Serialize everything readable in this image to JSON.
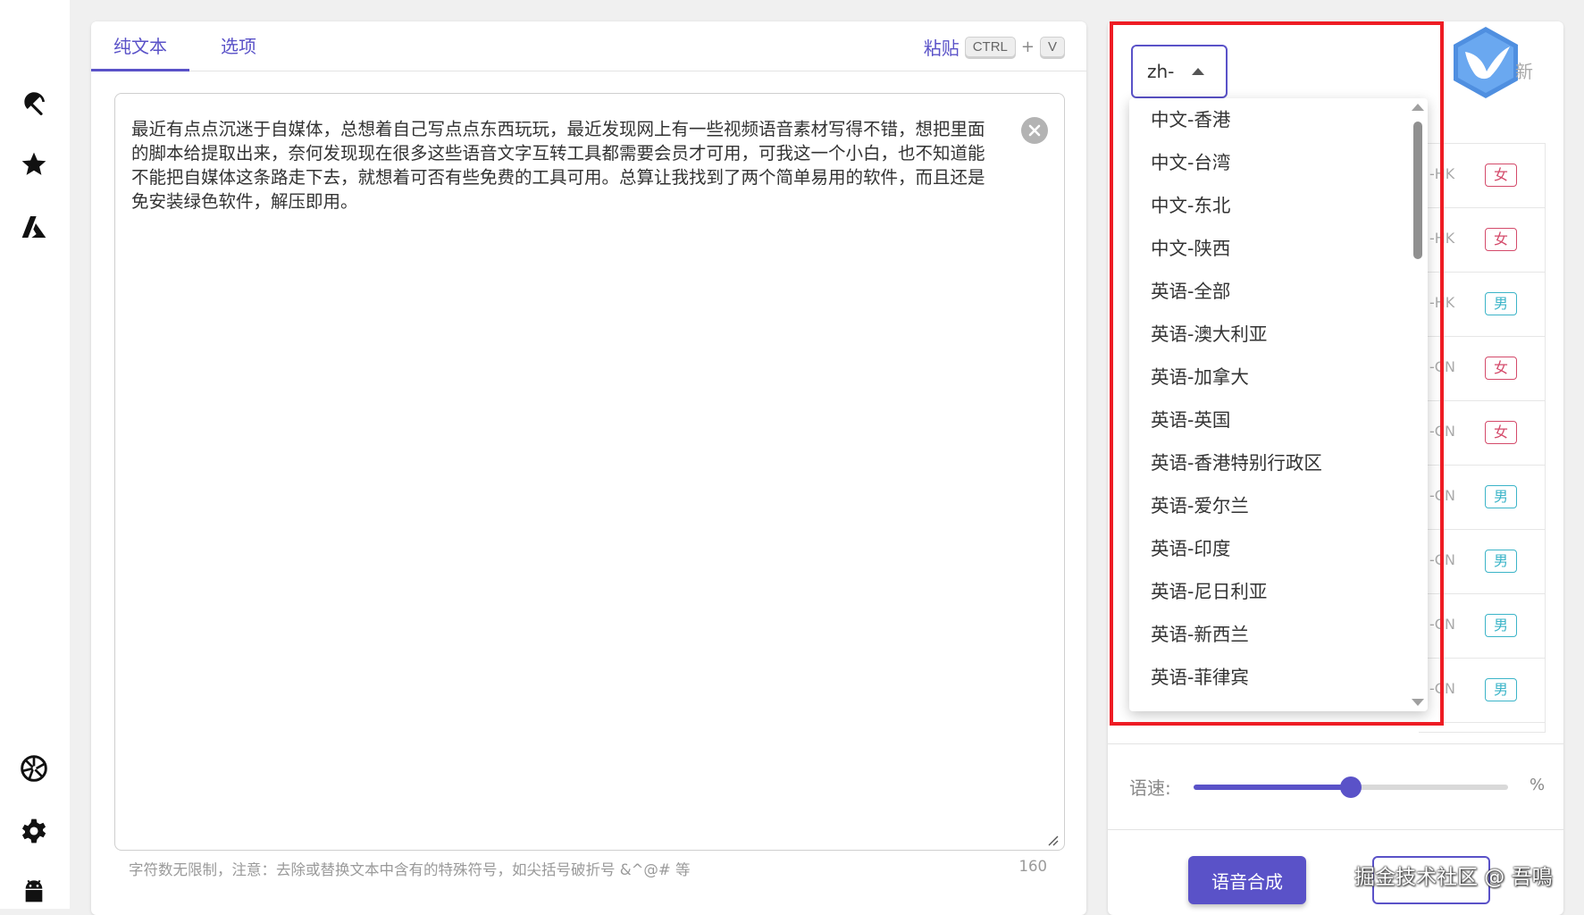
{
  "tabs": [
    {
      "label": "纯文本",
      "active": true
    },
    {
      "label": "选项",
      "active": false
    }
  ],
  "paste": {
    "label": "粘贴",
    "key1": "CTRL",
    "plus": "+",
    "key2": "V"
  },
  "editor": {
    "text": "最近有点点沉迷于自媒体，总想着自己写点点东西玩玩，最近发现网上有一些视频语音素材写得不错，想把里面的脚本给提取出来，奈何发现现在很多这些语音文字互转工具都需要会员才可用，可我这一个小白，也不知道能不能把自媒体这条路走下去，就想着可否有些免费的工具可用。总算让我找到了两个简单易用的软件，而且还是免安装绿色软件，解压即用。",
    "hint": "字符数无限制，注意：去除或替换文本中含有的特殊符号，如尖括号破折号 &^@# 等",
    "count": "160"
  },
  "language_select": {
    "value": "zh-"
  },
  "dropdown_options": [
    "中文-香港",
    "中文-台湾",
    "中文-东北",
    "中文-陕西",
    "英语-全部",
    "英语-澳大利亚",
    "英语-加拿大",
    "英语-英国",
    "英语-香港特别行政区",
    "英语-爱尔兰",
    "英语-印度",
    "英语-尼日利亚",
    "英语-新西兰",
    "英语-菲律宾"
  ],
  "partial_header": "新",
  "voices": [
    {
      "code": "-HK",
      "gender": "女"
    },
    {
      "code": "-HK",
      "gender": "女"
    },
    {
      "code": "-HK",
      "gender": "男"
    },
    {
      "code": "-CN",
      "gender": "女"
    },
    {
      "code": "-CN",
      "gender": "女"
    },
    {
      "code": "-CN",
      "gender": "男"
    },
    {
      "code": "-CN",
      "gender": "男"
    },
    {
      "code": "-CN",
      "gender": "男"
    },
    {
      "code": "-CN",
      "gender": "男"
    }
  ],
  "speed": {
    "label": "语速:",
    "unit": "%",
    "fraction": 0.5
  },
  "buttons": {
    "synthesize": "语音合成"
  },
  "watermark": "掘金技术社区 @ 吾鳴",
  "colors": {
    "accent": "#5a52c8",
    "highlight": "#ee1c24",
    "female": "#d44a6a",
    "male": "#3bb4c8"
  }
}
